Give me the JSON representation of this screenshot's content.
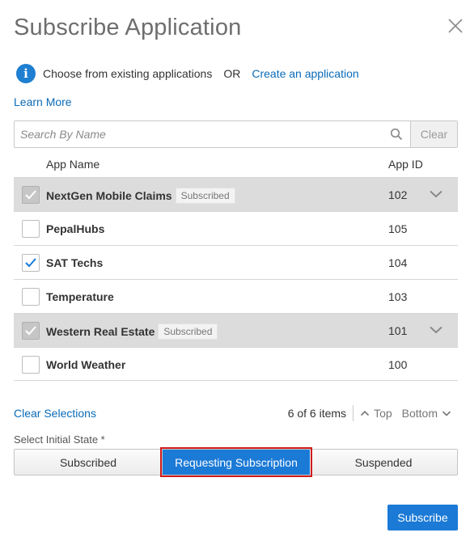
{
  "dialog": {
    "title": "Subscribe Application",
    "close_icon": "close-icon"
  },
  "info": {
    "text": "Choose from existing applications",
    "or": "OR",
    "create_link": "Create an application",
    "learn_more": "Learn More"
  },
  "search": {
    "placeholder": "Search By Name",
    "value": "",
    "clear_label": "Clear"
  },
  "table": {
    "columns": {
      "name": "App Name",
      "id": "App ID"
    },
    "rows": [
      {
        "name": "NextGen Mobile Claims",
        "badge": "Subscribed",
        "id": "102",
        "subscribed": true,
        "checked": true
      },
      {
        "name": "PepalHubs",
        "badge": "",
        "id": "105",
        "subscribed": false,
        "checked": false
      },
      {
        "name": "SAT Techs",
        "badge": "",
        "id": "104",
        "subscribed": false,
        "checked": true
      },
      {
        "name": "Temperature",
        "badge": "",
        "id": "103",
        "subscribed": false,
        "checked": false
      },
      {
        "name": "Western Real Estate",
        "badge": "Subscribed",
        "id": "101",
        "subscribed": true,
        "checked": true
      },
      {
        "name": "World Weather",
        "badge": "",
        "id": "100",
        "subscribed": false,
        "checked": false
      }
    ]
  },
  "footer": {
    "clear_selections": "Clear Selections",
    "count": "6 of 6 items",
    "top": "Top",
    "bottom": "Bottom"
  },
  "initial_state": {
    "label": "Select Initial State *",
    "options": [
      "Subscribed",
      "Requesting Subscription",
      "Suspended"
    ],
    "selected": "Requesting Subscription"
  },
  "actions": {
    "subscribe": "Subscribe"
  },
  "colors": {
    "accent": "#1b7ad6",
    "link": "#0a6bb8",
    "highlight": "#d01c1c",
    "subscribed_row": "#dcdcdc"
  }
}
